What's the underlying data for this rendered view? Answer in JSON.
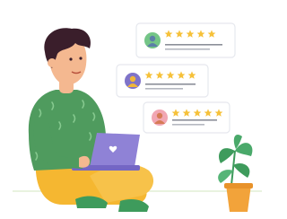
{
  "colors": {
    "card_bg": "#ffffff",
    "card_border": "#e6e8ee",
    "star": "#f6c13a",
    "shirt": "#4f9b5e",
    "pants": "#f5b731",
    "laptop": "#8f82d6",
    "skin": "#f4b890",
    "hair": "#3a1e2b",
    "pot": "#f2a33a",
    "leaf": "#3e9b5c"
  },
  "review_cards": [
    {
      "avatar_icon": "user-avatar-green-icon",
      "avatar_color": "#74c587",
      "face_color": "#5c7fa8",
      "rating": 5
    },
    {
      "avatar_icon": "user-avatar-purple-icon",
      "avatar_color": "#7f73c9",
      "face_color": "#f0b63a",
      "rating": 5
    },
    {
      "avatar_icon": "user-avatar-pink-icon",
      "avatar_color": "#f1a6b3",
      "face_color": "#d67b55",
      "rating": 5
    }
  ]
}
